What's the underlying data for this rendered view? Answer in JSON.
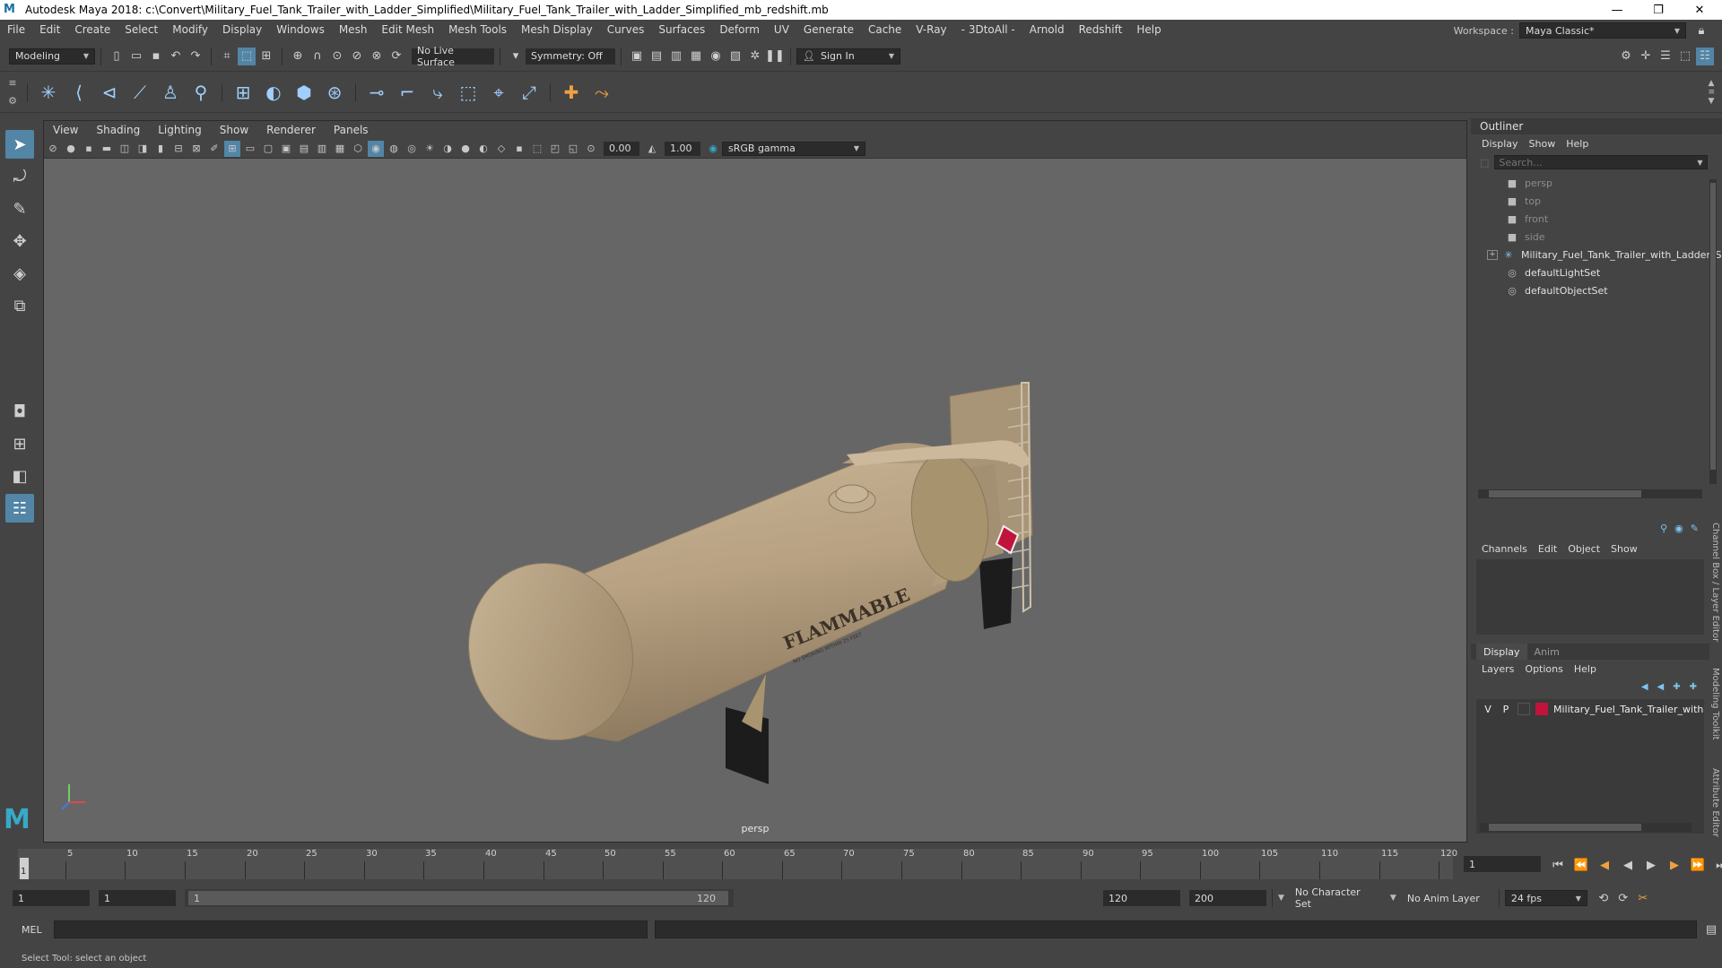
{
  "title_bar": {
    "title": "Autodesk Maya 2018: c:\\Convert\\Military_Fuel_Tank_Trailer_with_Ladder_Simplified\\Military_Fuel_Tank_Trailer_with_Ladder_Simplified_mb_redshift.mb",
    "logo": "M",
    "minimize": "—",
    "maximize": "❐",
    "close": "✕"
  },
  "menu_bar": {
    "items": [
      "File",
      "Edit",
      "Create",
      "Select",
      "Modify",
      "Display",
      "Windows",
      "Mesh",
      "Edit Mesh",
      "Mesh Tools",
      "Mesh Display",
      "Curves",
      "Surfaces",
      "Deform",
      "UV",
      "Generate",
      "Cache",
      "V-Ray",
      "- 3DtoAll -",
      "Arnold",
      "Redshift",
      "Help"
    ],
    "workspace_label": "Workspace :",
    "workspace_value": "Maya Classic*"
  },
  "status_line": {
    "mode": "Modeling",
    "live_surface": "No Live Surface",
    "symmetry": "Symmetry: Off",
    "sign_in": "Sign In"
  },
  "viewport": {
    "menu": [
      "View",
      "Shading",
      "Lighting",
      "Show",
      "Renderer",
      "Panels"
    ],
    "exposure": "0.00",
    "gamma": "1.00",
    "color_space": "sRGB gamma",
    "camera_label": "persp",
    "model_decal_main": "FLAMMABLE",
    "model_decal_sub": "NO SMOKING WITHIN 25 FEET"
  },
  "outliner": {
    "title": "Outliner",
    "menu": [
      "Display",
      "Show",
      "Help"
    ],
    "search_placeholder": "Search...",
    "items": [
      {
        "label": "persp",
        "icon": "camera-icon",
        "dim": true
      },
      {
        "label": "top",
        "icon": "camera-icon",
        "dim": true
      },
      {
        "label": "front",
        "icon": "camera-icon",
        "dim": true
      },
      {
        "label": "side",
        "icon": "camera-icon",
        "dim": true
      },
      {
        "label": "Military_Fuel_Tank_Trailer_with_Ladder_S",
        "icon": "transform-icon",
        "dim": false
      },
      {
        "label": "defaultLightSet",
        "icon": "set-icon",
        "dim": false
      },
      {
        "label": "defaultObjectSet",
        "icon": "set-icon",
        "dim": false
      }
    ]
  },
  "channel_box": {
    "menu": [
      "Channels",
      "Edit",
      "Object",
      "Show"
    ],
    "layer_tabs": [
      "Display",
      "Anim"
    ],
    "layer_menu": [
      "Layers",
      "Options",
      "Help"
    ],
    "layer": {
      "v": "V",
      "p": "P",
      "name": "Military_Fuel_Tank_Trailer_with",
      "color": "#c0143c"
    }
  },
  "right_tabs": [
    "Channel Box / Layer Editor",
    "Modeling Toolkit",
    "Attribute Editor"
  ],
  "time_slider": {
    "ticks": [
      5,
      10,
      15,
      20,
      25,
      30,
      35,
      40,
      45,
      50,
      55,
      60,
      65,
      70,
      75,
      80,
      85,
      90,
      95,
      100,
      105,
      110,
      115,
      120
    ],
    "current": "1",
    "current_field": "1"
  },
  "range_slider": {
    "start": "1",
    "playback_start": "1",
    "range_start": "1",
    "range_end": "120",
    "playback_end": "120",
    "end": "200",
    "character_set": "No Character Set",
    "anim_layer": "No Anim Layer",
    "fps": "24 fps"
  },
  "command_line": {
    "label": "MEL"
  },
  "help_line": {
    "text": "Select Tool: select an object"
  },
  "colors": {
    "accent": "#5285a6",
    "tank": "#b9a487",
    "viewport_bg": "#666666"
  }
}
